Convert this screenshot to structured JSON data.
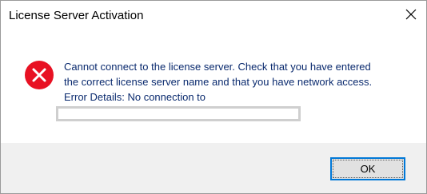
{
  "window": {
    "title": "License Server Activation",
    "close_icon": "close-icon"
  },
  "message": {
    "icon": "error-icon",
    "line1": "Cannot connect to the license server. Check that you have entered",
    "line2": "the correct license server name and that you have network access.",
    "line3": "Error Details: No connection to"
  },
  "buttons": {
    "ok_label": "OK"
  },
  "colors": {
    "text_accent": "#0a2a6e",
    "error_red": "#e81123",
    "focus_border": "#0078d7",
    "footer_bg": "#f0f0f0"
  }
}
